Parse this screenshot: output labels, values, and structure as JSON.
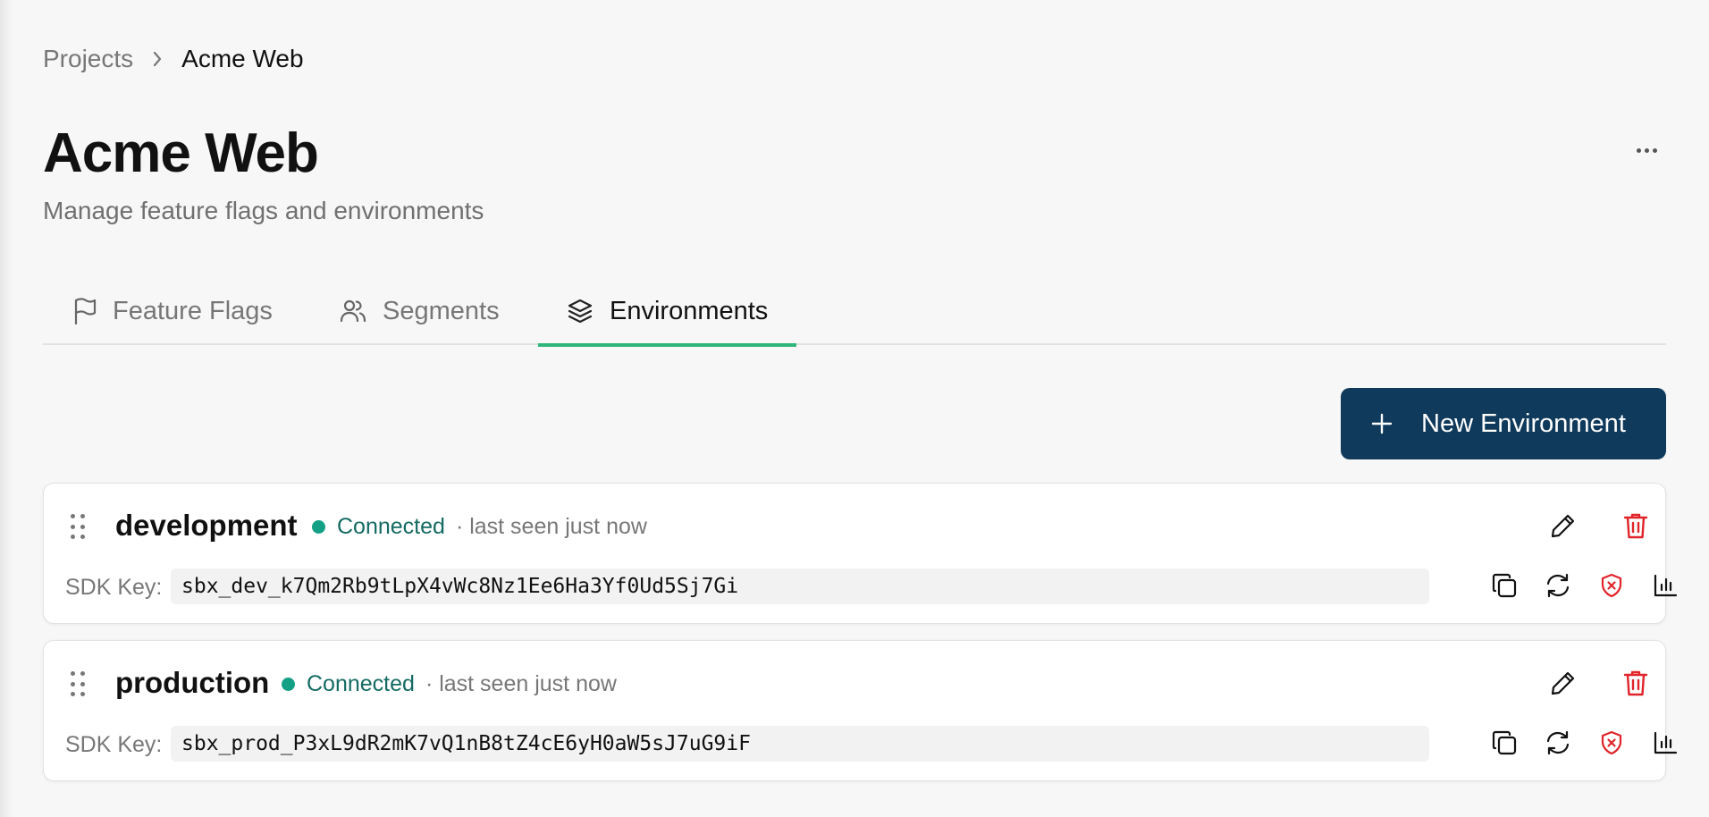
{
  "breadcrumb": {
    "parent": "Projects",
    "current": "Acme Web"
  },
  "header": {
    "title": "Acme Web",
    "subtitle": "Manage feature flags and environments"
  },
  "tabs": [
    {
      "label": "Feature Flags",
      "icon": "flag-icon",
      "active": false
    },
    {
      "label": "Segments",
      "icon": "users-icon",
      "active": false
    },
    {
      "label": "Environments",
      "icon": "layers-icon",
      "active": true
    }
  ],
  "actions": {
    "new_environment_label": "New Environment"
  },
  "colors": {
    "accent_tab": "#2fb67a",
    "primary_button": "#0f3a5b",
    "status_connected": "#14a085",
    "danger": "#e0242a"
  },
  "environments": [
    {
      "name": "development",
      "status": "Connected",
      "last_seen": "· last seen just now",
      "sdk_key_label": "SDK Key:",
      "sdk_key": "sbx_dev_k7Qm2Rb9tLpX4vWc8Nz1Ee6Ha3Yf0Ud5Sj7Gi"
    },
    {
      "name": "production",
      "status": "Connected",
      "last_seen": "· last seen just now",
      "sdk_key_label": "SDK Key:",
      "sdk_key": "sbx_prod_P3xL9dR2mK7vQ1nB8tZ4cE6yH0aW5sJ7uG9iF"
    }
  ]
}
